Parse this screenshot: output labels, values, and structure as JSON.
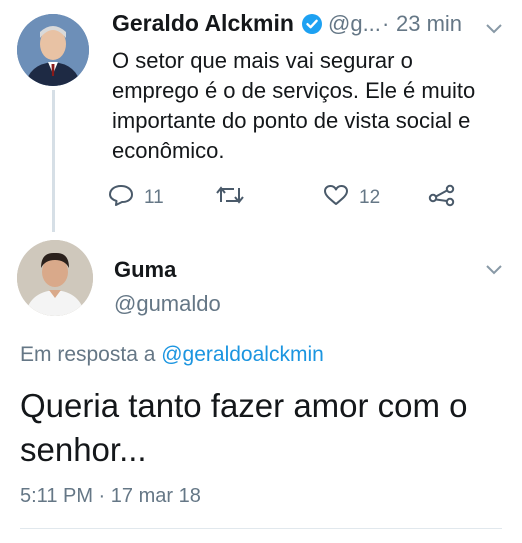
{
  "tweet1": {
    "author_name": "Geraldo Alckmin",
    "handle": "@g...",
    "separator": "·",
    "time": "23 min",
    "text": "O setor que mais vai segurar o emprego é o de serviços. Ele é muito importante do ponto de vista social e econômico.",
    "reply_count": "11",
    "like_count": "12",
    "verified": true
  },
  "tweet2": {
    "author_name": "Guma",
    "handle": "@gumaldo",
    "reply_prefix": "Em resposta a ",
    "reply_mention": "@geraldoalckmin",
    "text": "Queria tanto fazer amor com o senhor...",
    "timestamp": "5:11 PM · 17 mar 18"
  },
  "icons": {
    "reply": "reply-icon",
    "retweet": "retweet-icon",
    "like": "heart-icon",
    "share": "share-icon",
    "more": "chevron-down-icon",
    "verified": "verified-badge-icon"
  },
  "colors": {
    "muted": "#657786",
    "link": "#1b95e0",
    "verified": "#1da1f2"
  }
}
